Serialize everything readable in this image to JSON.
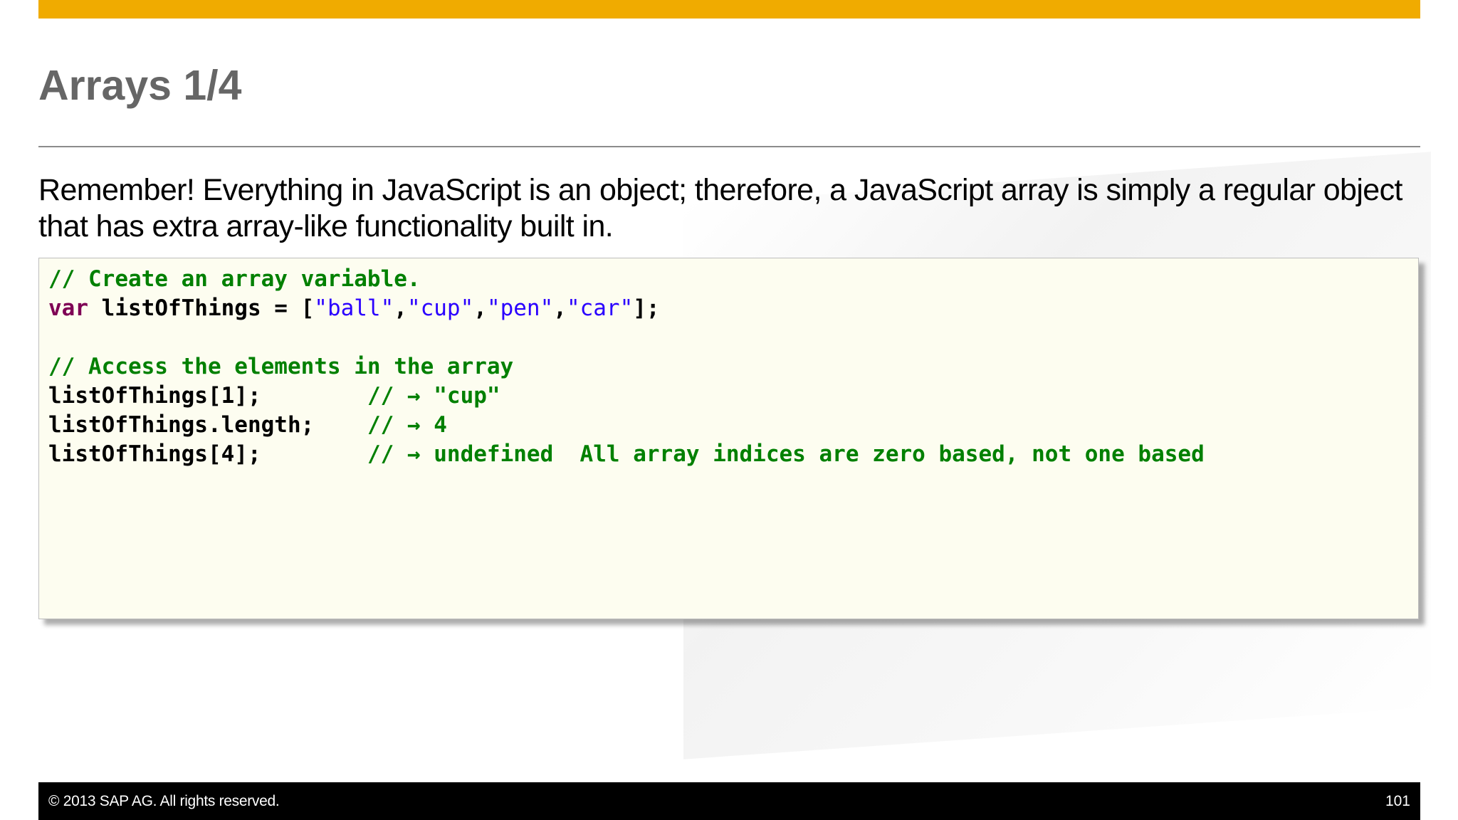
{
  "slide": {
    "title": "Arrays 1/4",
    "intro": "Remember!  Everything in JavaScript is an object; therefore, a JavaScript array is simply a regular object that has extra array-like functionality built in."
  },
  "code": {
    "line1": {
      "comment": "// Create an array variable."
    },
    "line2": {
      "keyword": "var",
      "text1": " listOfThings = [",
      "str1": "\"ball\"",
      "comma1": ",",
      "str2": "\"cup\"",
      "comma2": ",",
      "str3": "\"pen\"",
      "comma3": ",",
      "str4": "\"car\"",
      "end": "];"
    },
    "line4": {
      "comment": "// Access the elements in the array"
    },
    "line5": {
      "code": "listOfThings[1];        ",
      "comment": "// → \"cup\""
    },
    "line6": {
      "code": "listOfThings.length;    ",
      "comment": "// → 4"
    },
    "line7": {
      "code": "listOfThings[4];        ",
      "comment": "// → undefined  All array indices are zero based, not one based"
    }
  },
  "footer": {
    "copyright": "©  2013 SAP AG. All rights reserved.",
    "page_number": "101"
  },
  "colors": {
    "accent_bar": "#f0ab00",
    "comment": "#008000",
    "keyword": "#7f0055",
    "string": "#2a00ff",
    "code_background": "#fdfdf0"
  }
}
